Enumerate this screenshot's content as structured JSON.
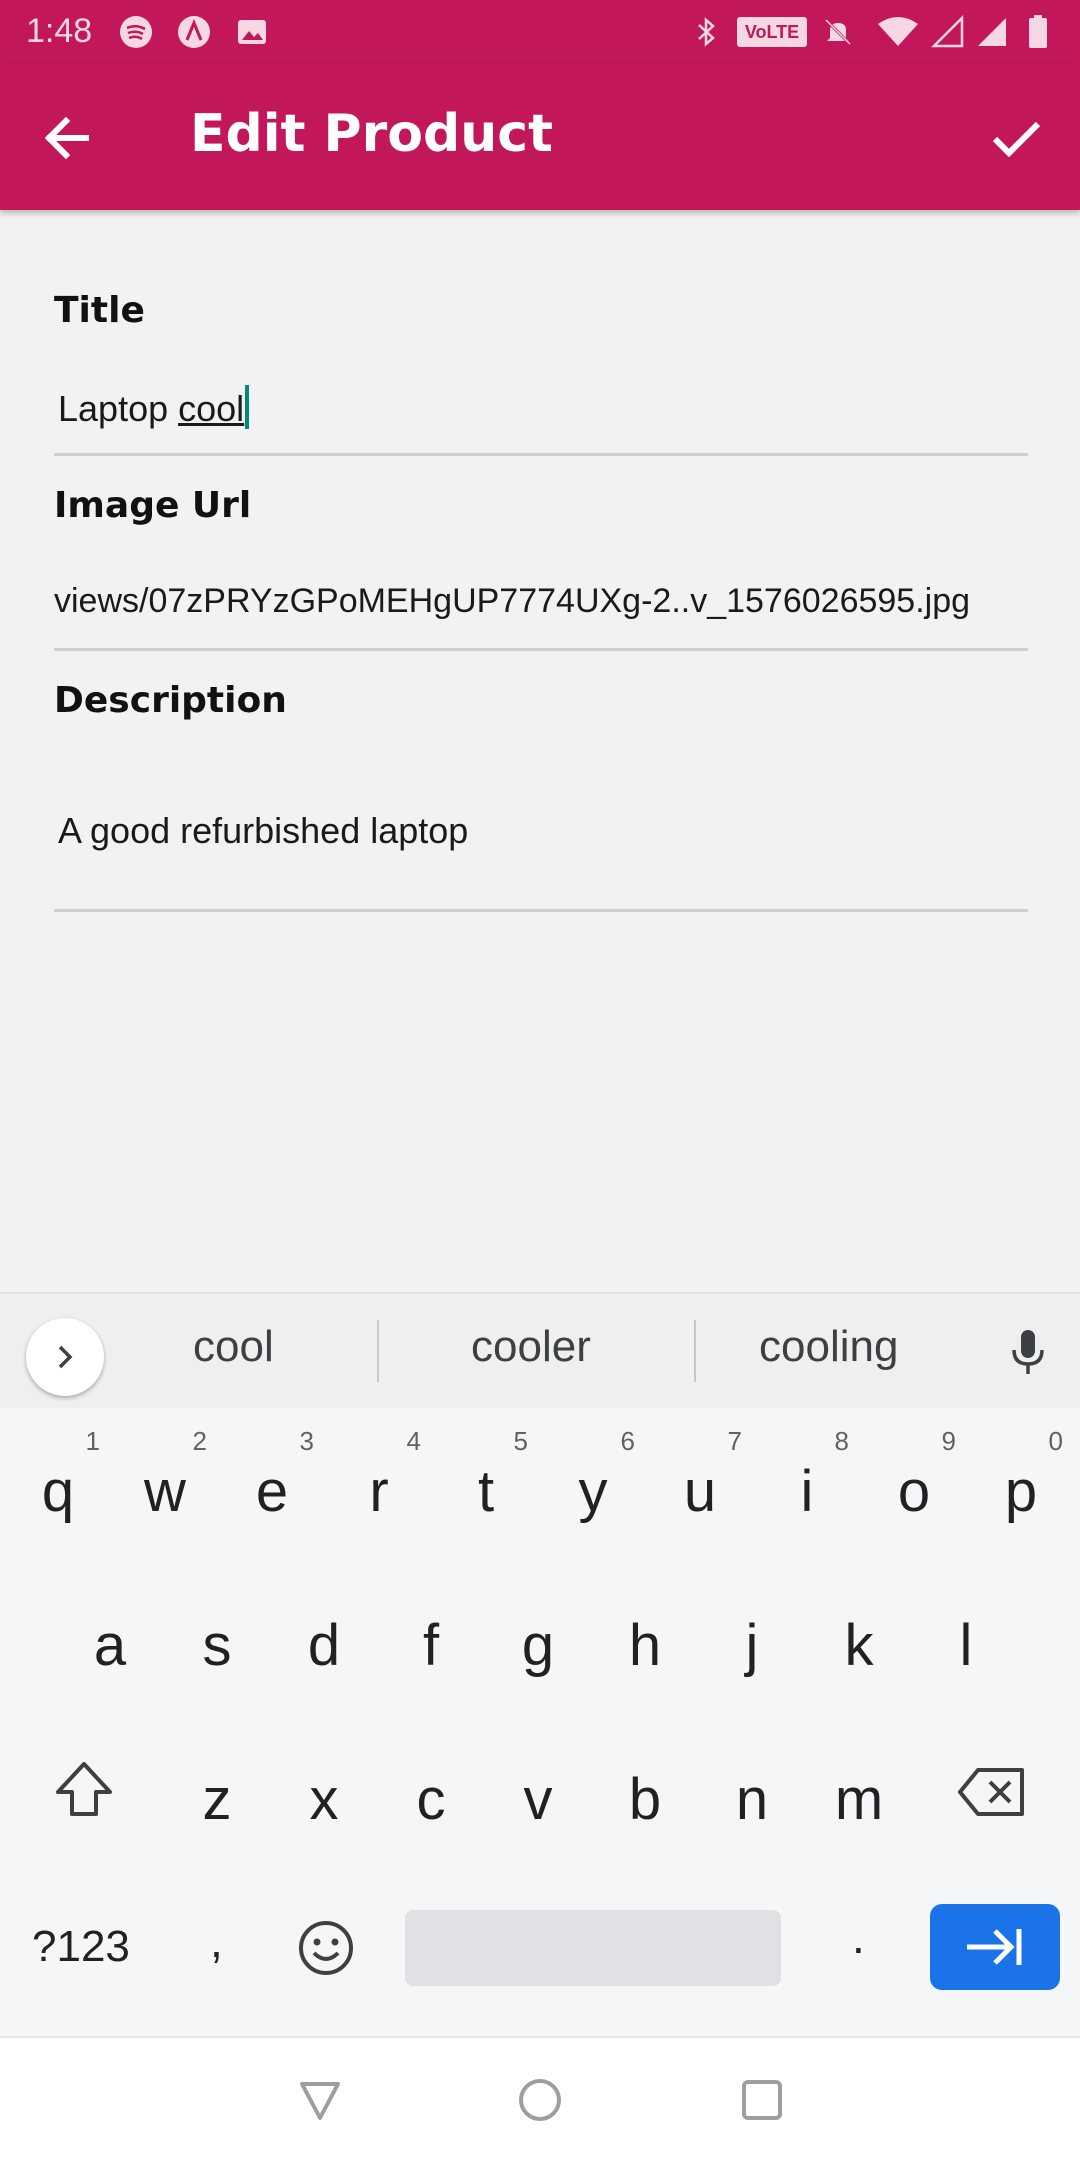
{
  "status_bar": {
    "time": "1:48",
    "volte_label": "VoLTE"
  },
  "app_bar": {
    "title": "Edit Product",
    "back_icon": "arrow-left-icon",
    "confirm_icon": "check-icon",
    "color": "#c2185b"
  },
  "form": {
    "title_label": "Title",
    "title_value_prefix": "Laptop ",
    "title_value_composing": "cool",
    "image_url_label": "Image Url",
    "image_url_value": "views/07zPRYzGPoMEHgUP7774UXg-2..v_1576026595.jpg",
    "description_label": "Description",
    "description_value": "A good refurbished laptop"
  },
  "keyboard": {
    "suggestions": [
      "cool",
      "cooler",
      "cooling"
    ],
    "row1": [
      {
        "ch": "q",
        "hint": "1"
      },
      {
        "ch": "w",
        "hint": "2"
      },
      {
        "ch": "e",
        "hint": "3"
      },
      {
        "ch": "r",
        "hint": "4"
      },
      {
        "ch": "t",
        "hint": "5"
      },
      {
        "ch": "y",
        "hint": "6"
      },
      {
        "ch": "u",
        "hint": "7"
      },
      {
        "ch": "i",
        "hint": "8"
      },
      {
        "ch": "o",
        "hint": "9"
      },
      {
        "ch": "p",
        "hint": "0"
      }
    ],
    "row2": [
      "a",
      "s",
      "d",
      "f",
      "g",
      "h",
      "j",
      "k",
      "l"
    ],
    "row3": [
      "z",
      "x",
      "c",
      "v",
      "b",
      "n",
      "m"
    ],
    "symbols_label": "?123",
    "comma_label": ",",
    "period_label": ".",
    "accent_color": "#1a73e8"
  }
}
